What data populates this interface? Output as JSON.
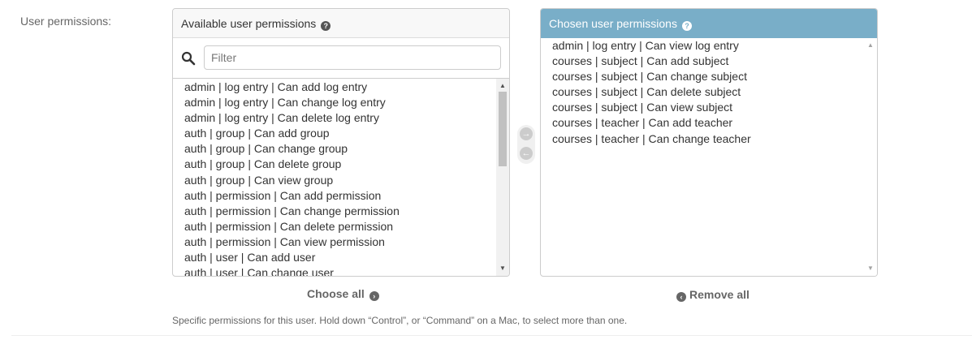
{
  "field_label": "User permissions:",
  "available": {
    "title": "Available user permissions",
    "help_icon": "question-circle-icon",
    "filter_placeholder": "Filter",
    "filter_value": "",
    "items": [
      "admin | log entry | Can add log entry",
      "admin | log entry | Can change log entry",
      "admin | log entry | Can delete log entry",
      "auth | group | Can add group",
      "auth | group | Can change group",
      "auth | group | Can delete group",
      "auth | group | Can view group",
      "auth | permission | Can add permission",
      "auth | permission | Can change permission",
      "auth | permission | Can delete permission",
      "auth | permission | Can view permission",
      "auth | user | Can add user",
      "auth | user | Can change user"
    ]
  },
  "chosen": {
    "title": "Chosen user permissions",
    "help_icon": "question-circle-icon",
    "items": [
      "admin | log entry | Can view log entry",
      "courses | subject | Can add subject",
      "courses | subject | Can change subject",
      "courses | subject | Can delete subject",
      "courses | subject | Can view subject",
      "courses | teacher | Can add teacher",
      "courses | teacher | Can change teacher"
    ]
  },
  "actions": {
    "choose_all": "Choose all",
    "remove_all": "Remove all"
  },
  "help_text": "Specific permissions for this user. Hold down “Control”, or “Command” on a Mac, to select more than one.",
  "colors": {
    "chosen_header": "#79aec8",
    "muted_text": "#666666"
  }
}
